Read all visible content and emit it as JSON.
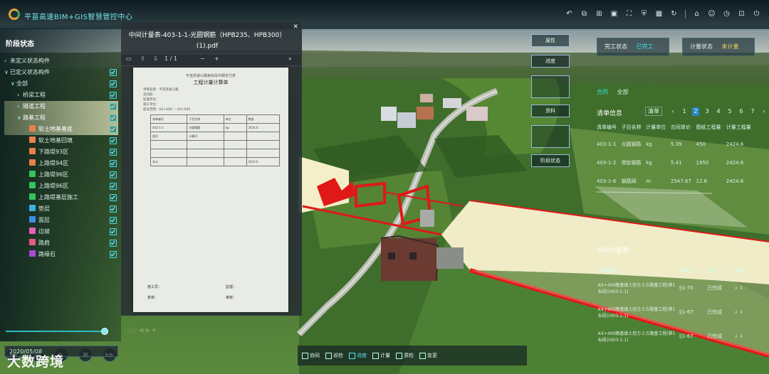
{
  "app": {
    "title": "平苗高速BIM+GIS智慧管控中心"
  },
  "topbar": {
    "icons": [
      "undo-icon",
      "layers-icon",
      "measure-icon",
      "image-icon",
      "fullscreen-icon",
      "shield-icon",
      "building-icon",
      "refresh-icon",
      "home-icon",
      "user-icon",
      "clock-icon",
      "grid-icon",
      "exit-icon"
    ]
  },
  "left_panel": {
    "title": "阶段状态",
    "tree": [
      {
        "label": "未定义状态构件",
        "indent": 0,
        "arrow": "›",
        "swatch": null
      },
      {
        "label": "已定义状态构件",
        "indent": 0,
        "arrow": "∨",
        "swatch": null
      },
      {
        "label": "全部",
        "indent": 1,
        "arrow": "∨",
        "swatch": null
      },
      {
        "label": "桥梁工程",
        "indent": 2,
        "arrow": "›",
        "swatch": null
      },
      {
        "label": "隧道工程",
        "indent": 2,
        "arrow": "›",
        "swatch": null,
        "highlight": true
      },
      {
        "label": "路基工程",
        "indent": 2,
        "arrow": "∨",
        "swatch": null,
        "highlight": true
      },
      {
        "label": "软土地基基底",
        "indent": 3,
        "arrow": "",
        "swatch": "#e8814a",
        "highlight": true
      },
      {
        "label": "软土地基回填",
        "indent": 3,
        "arrow": "",
        "swatch": "#e8814a"
      },
      {
        "label": "下路堤93区",
        "indent": 3,
        "arrow": "",
        "swatch": "#e8814a"
      },
      {
        "label": "上路堤94区",
        "indent": 3,
        "arrow": "",
        "swatch": "#e8814a"
      },
      {
        "label": "上路堤96区",
        "indent": 3,
        "arrow": "",
        "swatch": "#34c45a"
      },
      {
        "label": "上路堤96区",
        "indent": 3,
        "arrow": "",
        "swatch": "#34c45a"
      },
      {
        "label": "上路堤基层施工",
        "indent": 3,
        "arrow": "",
        "swatch": "#34c45a"
      },
      {
        "label": "垫层",
        "indent": 3,
        "arrow": "",
        "swatch": "#3ab0e6"
      },
      {
        "label": "面层",
        "indent": 3,
        "arrow": "",
        "swatch": "#3a8fe6"
      },
      {
        "label": "边坡",
        "indent": 3,
        "arrow": "",
        "swatch": "#e660b8"
      },
      {
        "label": "路肩",
        "indent": 3,
        "arrow": "",
        "swatch": "#e65a8a"
      },
      {
        "label": "路缘石",
        "indent": 3,
        "arrow": "",
        "swatch": "#a84ad6"
      }
    ],
    "speed": "x1",
    "date": "2020/05/08"
  },
  "pdf_viewer": {
    "title": "中间计量表-403-1-1-光圆钢筋（HPB235、HPB300）(1).pdf",
    "page_info": "1 / 1",
    "doc_header": "平苗高速公路第标段中期支付表",
    "doc_title": "工程计量计算单",
    "doc_lines": [
      "项目名称：平苗高速公路",
      "合同段：",
      "监理单位：",
      "施工单位：",
      "桩号范围：K4+400 一 K4+600"
    ],
    "table_rows": [
      [
        "清单编号",
        "子目名称",
        "单位",
        "数量"
      ],
      [
        "403-1-1",
        "光圆钢筋",
        "kg",
        "2424.6"
      ],
      [
        "部位",
        "计算式",
        "",
        ""
      ],
      [
        "",
        "",
        "",
        ""
      ],
      [
        "",
        "",
        "",
        ""
      ],
      [
        "合计",
        "",
        "",
        "2424.6"
      ]
    ],
    "signatures": [
      "施工员：",
      "监理：",
      "复核：",
      "审核："
    ]
  },
  "ghost_menu": [
    "阶段状态",
    "已定义状态构件",
    "全部",
    "桥梁",
    "隧道",
    "路基",
    "软土",
    "上路堤",
    "面层",
    "路肩",
    "路缘石"
  ],
  "map_buttons": [
    {
      "label": "属性",
      "type": "button"
    },
    {
      "label": "进度",
      "type": "button"
    },
    {
      "label": "",
      "type": "image"
    },
    {
      "label": "资料",
      "type": "button"
    },
    {
      "label": "",
      "type": "image"
    },
    {
      "label": "阶段状态",
      "type": "button"
    }
  ],
  "status_cards": [
    {
      "label": "完工状态",
      "value": "已完工",
      "color": "#36e1f0"
    },
    {
      "label": "计量状态",
      "value": "未计量",
      "color": "#f3d45a"
    }
  ],
  "right_panel": {
    "tabs": [
      "合同",
      "全部"
    ],
    "list_title": "清单信息",
    "pager": {
      "tag": "清单",
      "pages": [
        "‹",
        "1",
        "2",
        "3",
        "4",
        "5",
        "6",
        "7",
        "›"
      ],
      "current": "2"
    },
    "table": {
      "headers": [
        "清单编号",
        "子目名称",
        "计量单位",
        "合同单价",
        "图纸工程量",
        "计量工程量"
      ],
      "rows": [
        [
          "403-1-1",
          "光圆钢筋",
          "kg",
          "5.39",
          "450",
          "2424.6"
        ],
        [
          "403-1-2",
          "带肋钢筋",
          "kg",
          "5.41",
          "1950",
          "2424.6"
        ],
        [
          "403-1-6",
          "钢筋网",
          "m",
          "2547.67",
          "12.6",
          "2424.6"
        ]
      ]
    },
    "measure_title": "中间计量表",
    "measure_table": {
      "headers": [
        "清单名称",
        "申请人",
        "状态",
        "操作"
      ],
      "rows": [
        [
          "K4+400路基填土挖方土方路基工程(第1标段)(403-1-1)",
          "lj1-70",
          "已完成",
          "⌕ ⇩"
        ],
        [
          "K4+400路基填土挖方土方路基工程(第1标段)(403-1-1)",
          "lj1-67",
          "已完成",
          "⌕ ⇩"
        ],
        [
          "K4+400路基填土挖方土方路基工程(第1标段)(403-1-1)",
          "lj1-67",
          "已完成",
          "⌕ ⇩"
        ]
      ]
    }
  },
  "bottom_toolbar": [
    {
      "label": "协同",
      "active": false
    },
    {
      "label": "巡检",
      "active": false
    },
    {
      "label": "进度",
      "active": true
    },
    {
      "label": "计量",
      "active": false
    },
    {
      "label": "质检",
      "active": false
    },
    {
      "label": "变更",
      "active": false
    }
  ],
  "watermark": "大数跨境",
  "colors": {
    "accent": "#36e1f0",
    "model_red": "#e01818",
    "model_cream": "#f4eec9"
  }
}
